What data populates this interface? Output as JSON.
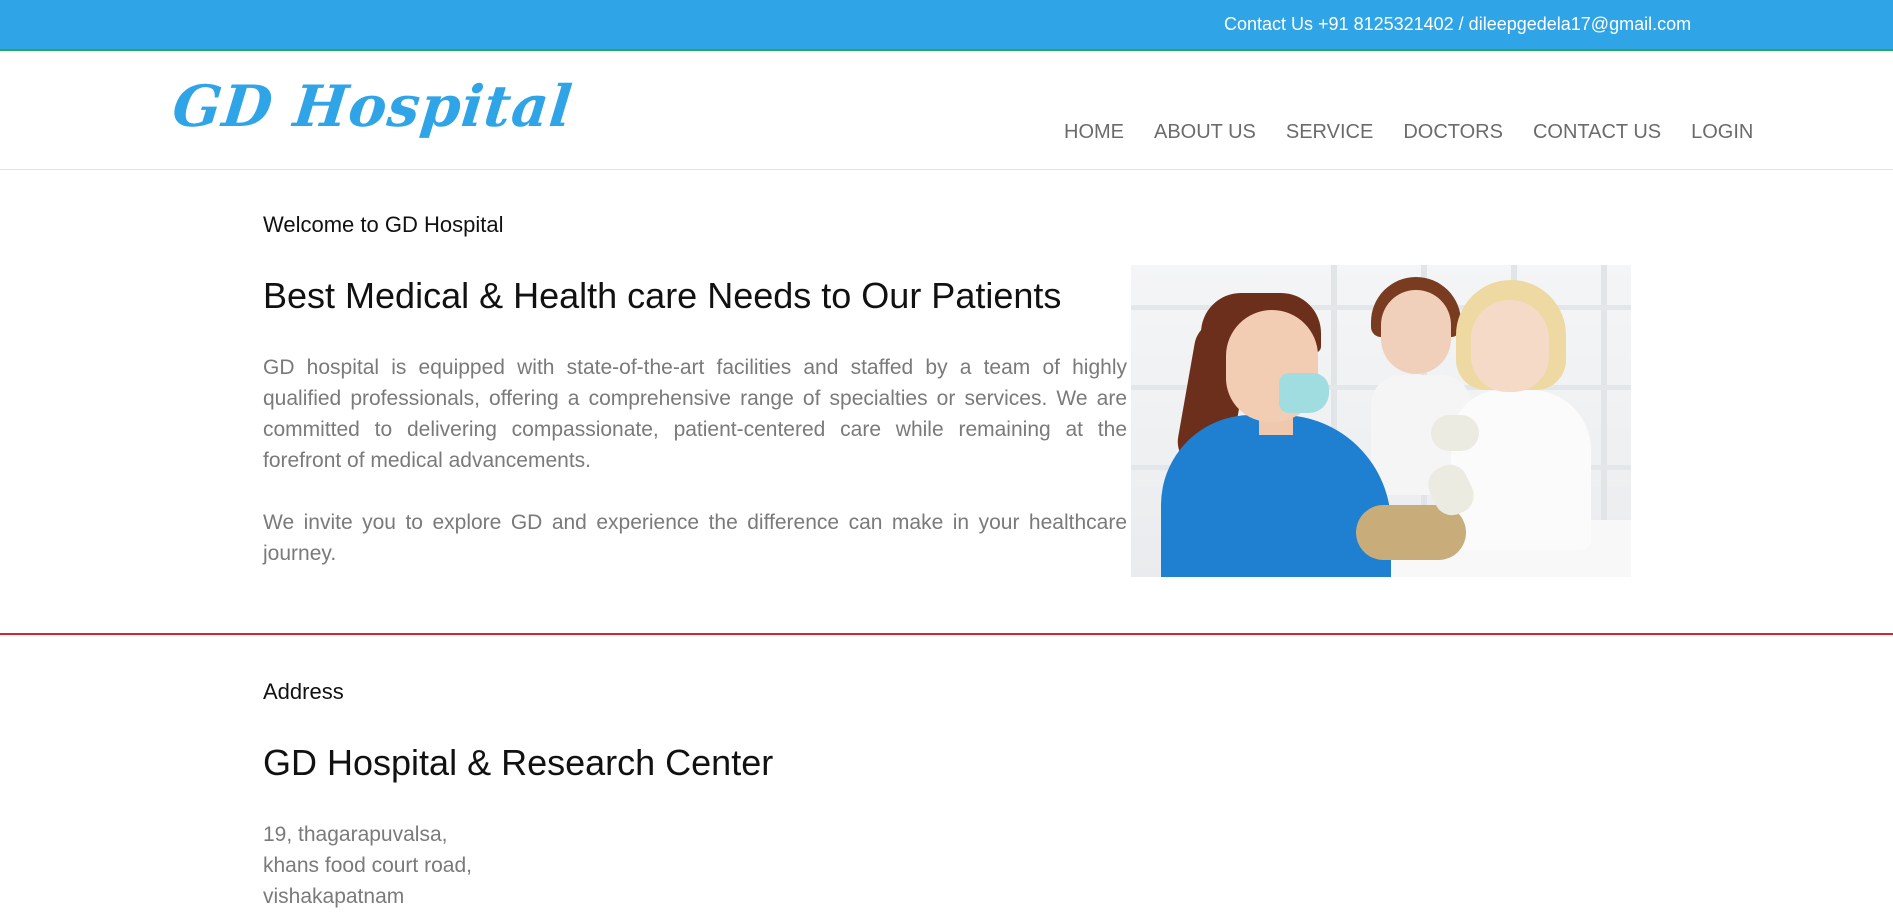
{
  "topbar": {
    "contact_text": "Contact Us +91 8125321402 / dileepgedela17@gmail.com"
  },
  "header": {
    "logo": "GD Hospital",
    "nav": [
      {
        "label": "HOME"
      },
      {
        "label": "ABOUT US"
      },
      {
        "label": "SERVICE"
      },
      {
        "label": "DOCTORS"
      },
      {
        "label": "CONTACT US"
      },
      {
        "label": "LOGIN"
      }
    ]
  },
  "welcome": {
    "eyebrow": "Welcome to GD Hospital",
    "headline": "Best Medical & Health care Needs to Our Patients",
    "paragraphs": [
      "GD hospital is equipped with state-of-the-art facilities and staffed by a team of highly qualified professionals, offering a comprehensive range of specialties or services. We are committed to delivering compassionate, patient-centered care while remaining at the forefront of medical advancements.",
      "We invite you to explore GD and experience the difference can make in your healthcare journey."
    ]
  },
  "address": {
    "eyebrow": "Address",
    "name": "GD Hospital & Research Center",
    "lines": [
      "19, thagarapuvalsa,",
      "khans food court road,",
      "vishakapatnam"
    ]
  },
  "colors": {
    "brand": "#2fa4e7",
    "divider": "#d9232e",
    "body_text": "#7a7a7a"
  }
}
